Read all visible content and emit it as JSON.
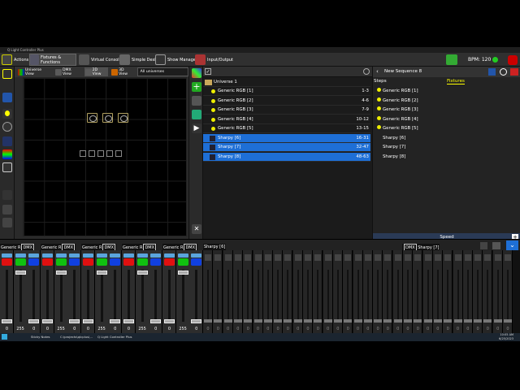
{
  "window": {
    "title": "Q Light Controller Plus"
  },
  "topbar": {
    "tabs": [
      {
        "label": "Actions",
        "icon": "actions-icon"
      },
      {
        "label": "Fixtures & Functions",
        "icon": "fixtures-icon"
      },
      {
        "label": "Virtual Console",
        "icon": "virtual-console-icon"
      },
      {
        "label": "Simple Desk",
        "icon": "simple-desk-icon"
      },
      {
        "label": "Show Manager",
        "icon": "show-manager-icon"
      },
      {
        "label": "Input/Output",
        "icon": "input-output-icon"
      }
    ],
    "bpm": "BPM: 120"
  },
  "views": {
    "universe": "Universe View",
    "dmx": "DMX View",
    "v2d": "2D View",
    "v3d": "3D View",
    "universe_select": "All universes"
  },
  "fixture_list": {
    "group": "Universe 1",
    "rows": [
      {
        "name": "Generic RGB [1]",
        "addr": "1-3",
        "selected": false,
        "type": "rgb"
      },
      {
        "name": "Generic RGB [2]",
        "addr": "4-6",
        "selected": false,
        "type": "rgb"
      },
      {
        "name": "Generic RGB [3]",
        "addr": "7-9",
        "selected": false,
        "type": "rgb"
      },
      {
        "name": "Generic RGB [4]",
        "addr": "10-12",
        "selected": false,
        "type": "rgb"
      },
      {
        "name": "Generic RGB [5]",
        "addr": "13-15",
        "selected": false,
        "type": "rgb"
      },
      {
        "name": "Sharpy [6]",
        "addr": "16-31",
        "selected": true,
        "type": "sharpy"
      },
      {
        "name": "Sharpy [7]",
        "addr": "32-47",
        "selected": true,
        "type": "sharpy"
      },
      {
        "name": "Sharpy [8]",
        "addr": "48-63",
        "selected": true,
        "type": "sharpy"
      }
    ]
  },
  "sequence": {
    "title": "New Sequence 8",
    "steps_tab": "Steps",
    "fixtures_tab": "Fixtures",
    "fixtures": [
      "Generic RGB [1]",
      "Generic RGB [2]",
      "Generic RGB [3]",
      "Generic RGB [4]",
      "Generic RGB [5]",
      "Sharpy [6]",
      "Sharpy [7]",
      "Sharpy [8]"
    ],
    "speed": "Speed"
  },
  "mixer": {
    "groups": [
      {
        "label": "Generic R",
        "dmx": "DMX"
      },
      {
        "label": "Generic R",
        "dmx": "DMX"
      },
      {
        "label": "Generic R",
        "dmx": "DMX"
      },
      {
        "label": "Generic R",
        "dmx": "DMX"
      },
      {
        "label": "Generic R",
        "dmx": "DMX"
      }
    ],
    "sharpy_labels": [
      "Sharpy [6]",
      "Sharpy [7]"
    ],
    "sharpy_dmx": "DMX",
    "rgb_values": [
      "0",
      "255",
      "0"
    ],
    "rgb_levels": [
      0,
      1,
      0
    ],
    "dim_value": "0",
    "colors": [
      "#e01010",
      "#10c010",
      "#1040e0"
    ]
  },
  "taskbar": {
    "items": [
      "Sticky Notes",
      "C:\\projects\\qlcplus\\...",
      "Q Light Controller Plus"
    ],
    "time": "10:05 AM",
    "date": "6/25/2023"
  }
}
